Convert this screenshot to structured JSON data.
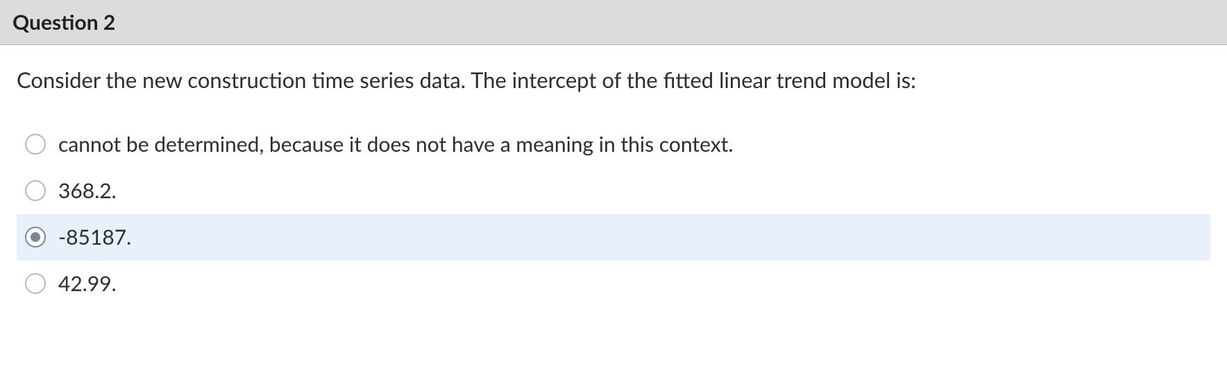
{
  "question": {
    "header": "Question 2",
    "prompt": "Consider the new construction time series data. The intercept of the fitted linear trend model is:",
    "options": [
      {
        "label": "cannot be determined, because it does not have a meaning in this context.",
        "selected": false
      },
      {
        "label": "368.2.",
        "selected": false
      },
      {
        "label": "-85187.",
        "selected": true
      },
      {
        "label": "42.99.",
        "selected": false
      }
    ]
  }
}
